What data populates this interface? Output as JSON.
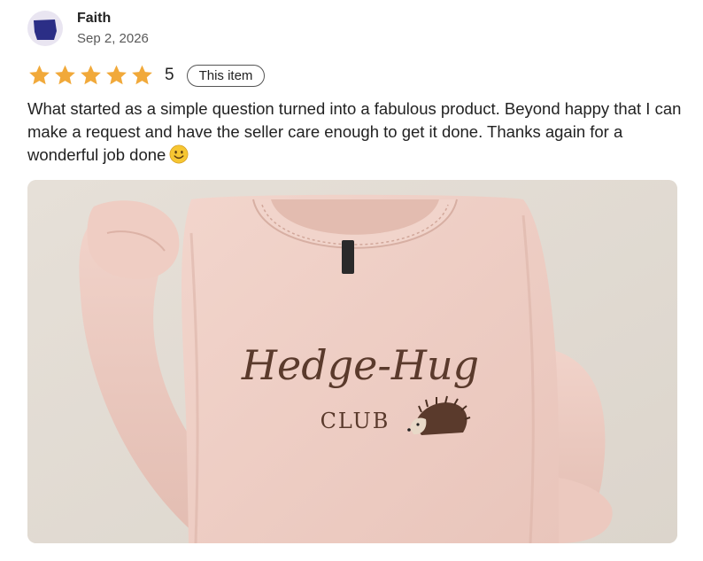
{
  "review": {
    "author": "Faith",
    "date": "Sep 2, 2026",
    "rating": 5,
    "rating_label": "5",
    "this_item_label": "This item",
    "text": "What started as a simple question turned into a fabulous product. Beyond happy that I can make a request and have the seller care enough to get it done. Thanks again for a wonderful job done"
  },
  "photo": {
    "embroidery_line1": "Hedge-Hug",
    "embroidery_line2": "CLUB",
    "colors": {
      "background": "#e3ddd5",
      "sweatshirt": "#efcfc6",
      "embroidery": "#5a3a2c"
    }
  },
  "icons": {
    "avatar": "avatar-shape-icon",
    "star": "star-icon",
    "emoji": "smiling-face-emoji"
  },
  "colors": {
    "star": "#f1a93a",
    "avatar_bg": "#e9e5f1",
    "avatar_shape": "#2b2e86"
  }
}
